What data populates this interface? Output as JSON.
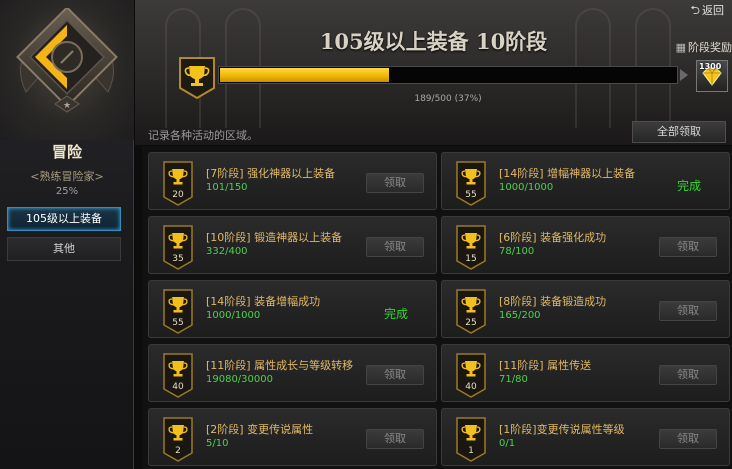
{
  "header": {
    "back_label": "返回",
    "title": "105级以上装备 10阶段",
    "progress_text": "189/500 (37%)",
    "progress_fraction": 0.37,
    "reward_label": "阶段奖励",
    "reward_qty": "1300"
  },
  "category": {
    "title": "冒险",
    "subtitle": "<熟练冒险家>",
    "percent": "25%"
  },
  "sidebar": {
    "items": [
      {
        "label": "105级以上装备",
        "active": true
      },
      {
        "label": "其他",
        "active": false
      }
    ]
  },
  "list": {
    "description": "记录各种活动的区域。",
    "claim_all_label": "全部领取"
  },
  "achievements": [
    {
      "level": "20",
      "title": "[7阶段] 强化神器以上装备",
      "progress": "101/150",
      "status": "领取",
      "done": false
    },
    {
      "level": "55",
      "title": "[14阶段] 增幅神器以上装备",
      "progress": "1000/1000",
      "status": "完成",
      "done": true
    },
    {
      "level": "35",
      "title": "[10阶段] 锻造神器以上装备",
      "progress": "332/400",
      "status": "领取",
      "done": false
    },
    {
      "level": "15",
      "title": "[6阶段] 装备强化成功",
      "progress": "78/100",
      "status": "领取",
      "done": false
    },
    {
      "level": "55",
      "title": "[14阶段] 装备增幅成功",
      "progress": "1000/1000",
      "status": "完成",
      "done": true
    },
    {
      "level": "25",
      "title": "[8阶段] 装备锻造成功",
      "progress": "165/200",
      "status": "领取",
      "done": false
    },
    {
      "level": "40",
      "title": "[11阶段] 属性成长与等级转移",
      "progress": "19080/30000",
      "status": "领取",
      "done": false
    },
    {
      "level": "40",
      "title": "[11阶段] 属性传送",
      "progress": "71/80",
      "status": "领取",
      "done": false
    },
    {
      "level": "2",
      "title": "[2阶段] 变更传说属性",
      "progress": "5/10",
      "status": "领取",
      "done": false
    },
    {
      "level": "1",
      "title": "[1阶段]变更传说属性等级",
      "progress": "0/1",
      "status": "领取",
      "done": false
    }
  ],
  "colors": {
    "accent_gold": "#f1b800",
    "complete_green": "#33d633",
    "progress_green": "#4bd24b",
    "active_tab_blue": "#2f8fc2"
  }
}
